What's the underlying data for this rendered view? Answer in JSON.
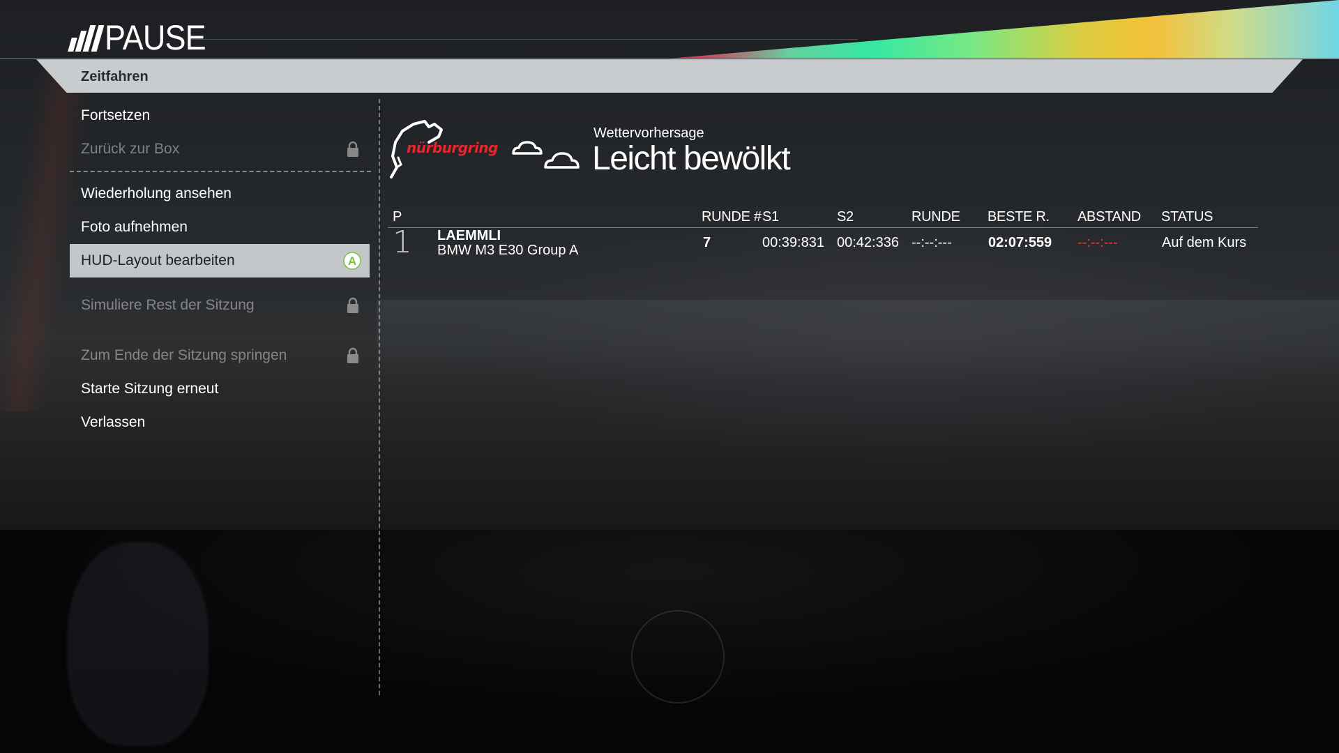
{
  "header": {
    "title": "PAUSE"
  },
  "mode": {
    "label": "Zeitfahren"
  },
  "menu": {
    "items": [
      {
        "label": "Fortsetzen",
        "state": "enabled"
      },
      {
        "label": "Zurück zur Box",
        "state": "locked"
      },
      {
        "label": "Wiederholung ansehen",
        "state": "enabled"
      },
      {
        "label": "Foto aufnehmen",
        "state": "enabled"
      },
      {
        "label": "HUD-Layout bearbeiten",
        "state": "selected",
        "button_hint": "A"
      },
      {
        "label": "Simuliere Rest der Sitzung",
        "state": "locked"
      },
      {
        "label": "Zum Ende der Sitzung springen",
        "state": "locked"
      },
      {
        "label": "Starte Sitzung erneut",
        "state": "enabled"
      },
      {
        "label": "Verlassen",
        "state": "enabled"
      }
    ]
  },
  "track": {
    "name": "nürburgring",
    "brand_color": "#e8242d"
  },
  "weather": {
    "title": "Wettervorhersage",
    "value": "Leicht bewölkt",
    "icon": "clouds-icon"
  },
  "standings": {
    "columns": [
      "P",
      "RUNDE #",
      "S1",
      "S2",
      "RUNDE",
      "BESTE R.",
      "ABSTAND",
      "STATUS"
    ],
    "rows": [
      {
        "position": "1",
        "driver": "LAEMMLI",
        "car": "BMW M3 E30 Group A",
        "lap": "7",
        "s1": "00:39:831",
        "s2": "00:42:336",
        "lap_time": "--:--:---",
        "best_lap": "02:07:559",
        "gap": "--:--:---",
        "gap_color": "#e0413a",
        "status": "Auf dem Kurs"
      }
    ]
  },
  "colors": {
    "selected_bg": "#c3c6c8",
    "mode_bar_bg": "#c9ccce",
    "button_a": "#7ac142"
  }
}
